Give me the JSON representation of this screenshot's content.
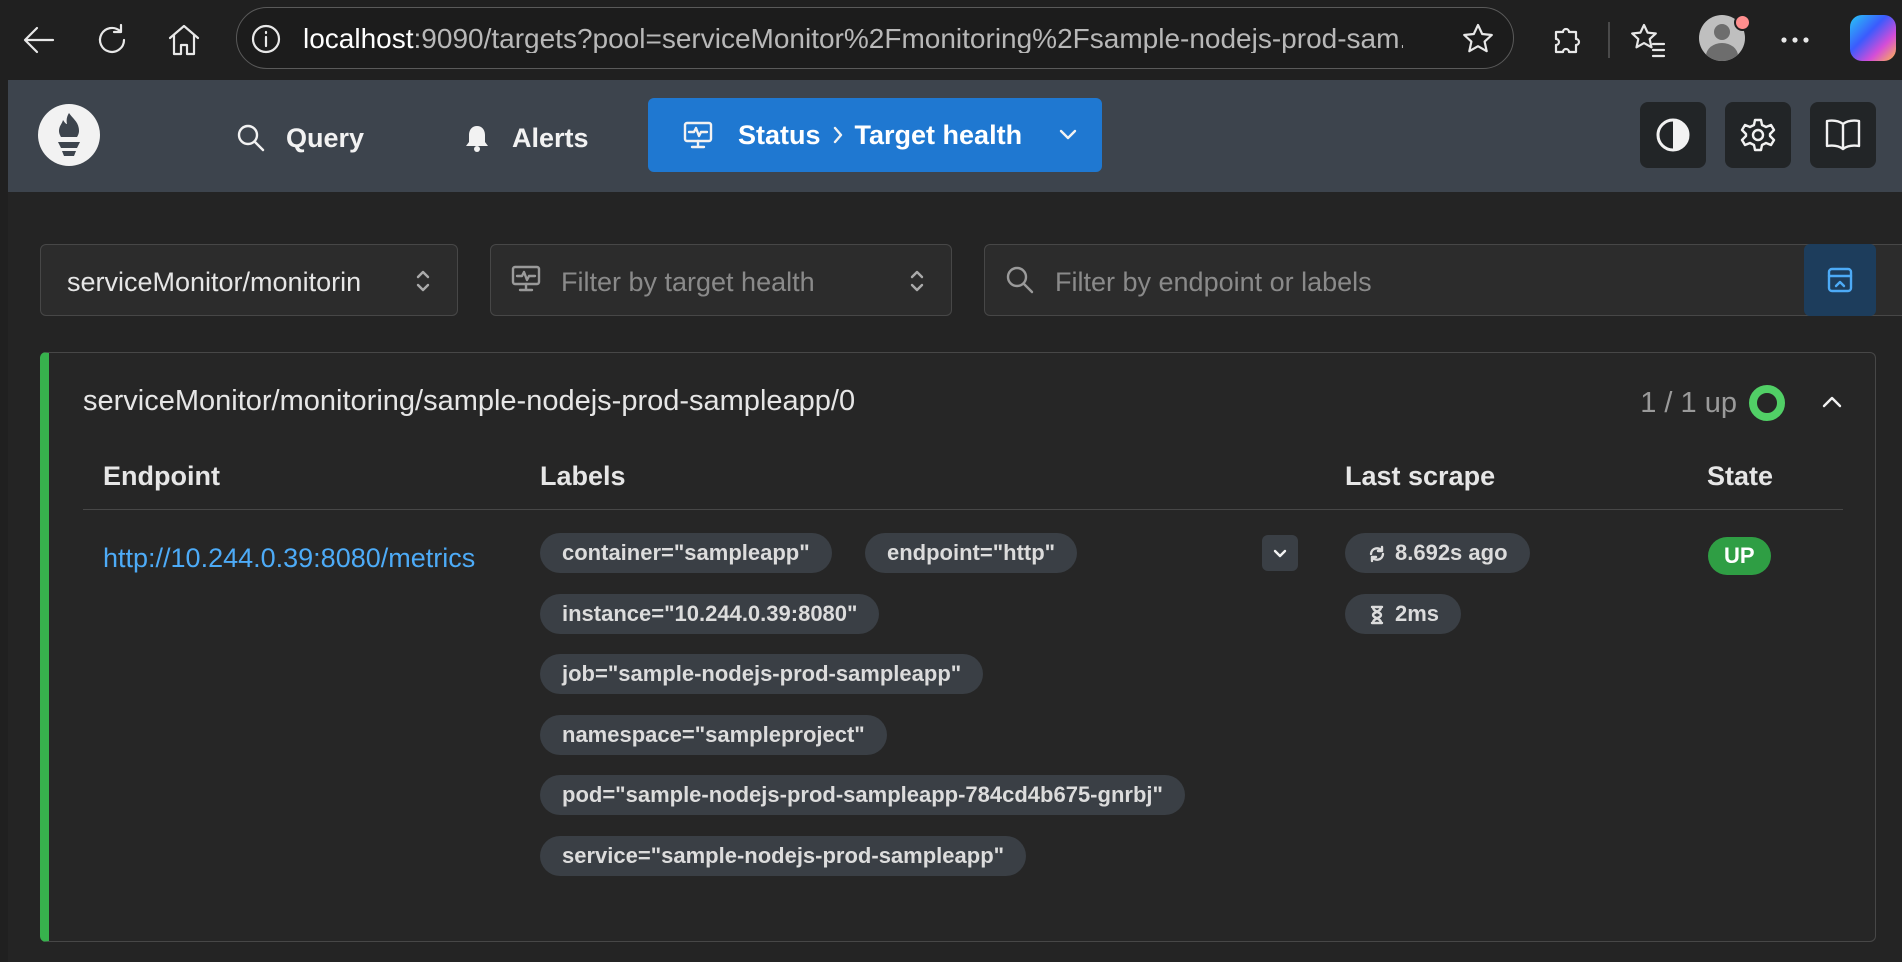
{
  "browser": {
    "url_host": "localhost",
    "url_rest": ":9090/targets?pool=serviceMonitor%2Fmonitoring%2Fsample-nodejs-prod-sam..."
  },
  "nav": {
    "query_label": "Query",
    "alerts_label": "Alerts",
    "status_label": "Status",
    "status_sub_label": "Target health"
  },
  "filters": {
    "pool_value": "serviceMonitor/monitorin",
    "health_placeholder": "Filter by target health",
    "search_placeholder": "Filter by endpoint or labels"
  },
  "pool": {
    "title": "serviceMonitor/monitoring/sample-nodejs-prod-sampleapp/0",
    "count": "1 / 1 up",
    "columns": {
      "endpoint": "Endpoint",
      "labels": "Labels",
      "last_scrape": "Last scrape",
      "state": "State"
    },
    "target": {
      "endpoint": "http://10.244.0.39:8080/metrics",
      "labels": [
        "container=\"sampleapp\"",
        "endpoint=\"http\"",
        "instance=\"10.244.0.39:8080\"",
        "job=\"sample-nodejs-prod-sampleapp\"",
        "namespace=\"sampleproject\"",
        "pod=\"sample-nodejs-prod-sampleapp-784cd4b675-gnrbj\"",
        "service=\"sample-nodejs-prod-sampleapp\""
      ],
      "last_scrape": "8.692s ago",
      "scrape_duration": "2ms",
      "state": "UP"
    }
  },
  "colors": {
    "accent": "#1f78d1",
    "healthy": "#51cf66",
    "up_badge": "#2f9e44",
    "link": "#4dabf7"
  },
  "icons": [
    "back-icon",
    "reload-icon",
    "home-icon",
    "info-icon",
    "star-icon",
    "extensions-icon",
    "favorites-icon",
    "more-icon",
    "prometheus-logo",
    "search-icon",
    "bell-icon",
    "monitor-icon",
    "chevron-down-icon",
    "theme-icon",
    "gear-icon",
    "book-icon",
    "updown-icon",
    "collapse-all-icon",
    "chevron-up-icon",
    "refresh-icon",
    "hourglass-icon"
  ]
}
